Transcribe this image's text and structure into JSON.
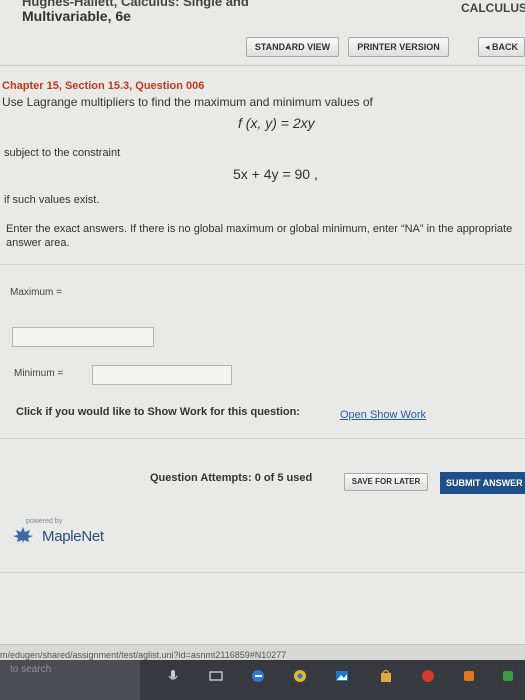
{
  "header": {
    "book_title_line1": "Hughes-Hallett, Calculus: Single and",
    "book_title_line2": "Multivariable, 6e",
    "course": "CALCULUS"
  },
  "toolbar": {
    "standard_view": "STANDARD VIEW",
    "printer_version": "PRINTER VERSION",
    "back": "◂ BACK"
  },
  "question": {
    "heading": "Chapter 15, Section 15.3, Question 006",
    "prompt": "Use Lagrange multipliers to find the maximum and minimum values of",
    "function": "f (x, y) = 2xy",
    "subject_to": "subject to the constraint",
    "constraint": "5x + 4y = 90 ,",
    "if_exist": "if such values exist.",
    "instructions": "Enter the exact answers. If there is no global maximum or global minimum, enter “NA” in the appropriate answer area."
  },
  "answers": {
    "max_label": "Maximum  =",
    "max_value": "",
    "min_label": "Minimum  =",
    "min_value": "",
    "show_work_prompt": "Click if you would like to Show Work for this question:",
    "show_work_link": "Open Show Work"
  },
  "footer": {
    "attempts": "Question Attempts: 0 of 5 used",
    "save_later": "SAVE FOR LATER",
    "submit": "SUBMIT ANSWER",
    "powered_by": "powered by",
    "brand": "MapleNet"
  },
  "browser": {
    "url": "m/edugen/shared/assignment/test/aglist.uni?id=asnmt2116859#N10277",
    "search_placeholder": "to search"
  },
  "colors": {
    "heading_red": "#c13a1b",
    "link_blue": "#245ba6",
    "submit_bg": "#1f4f8a",
    "taskbar": "#363a3f"
  }
}
